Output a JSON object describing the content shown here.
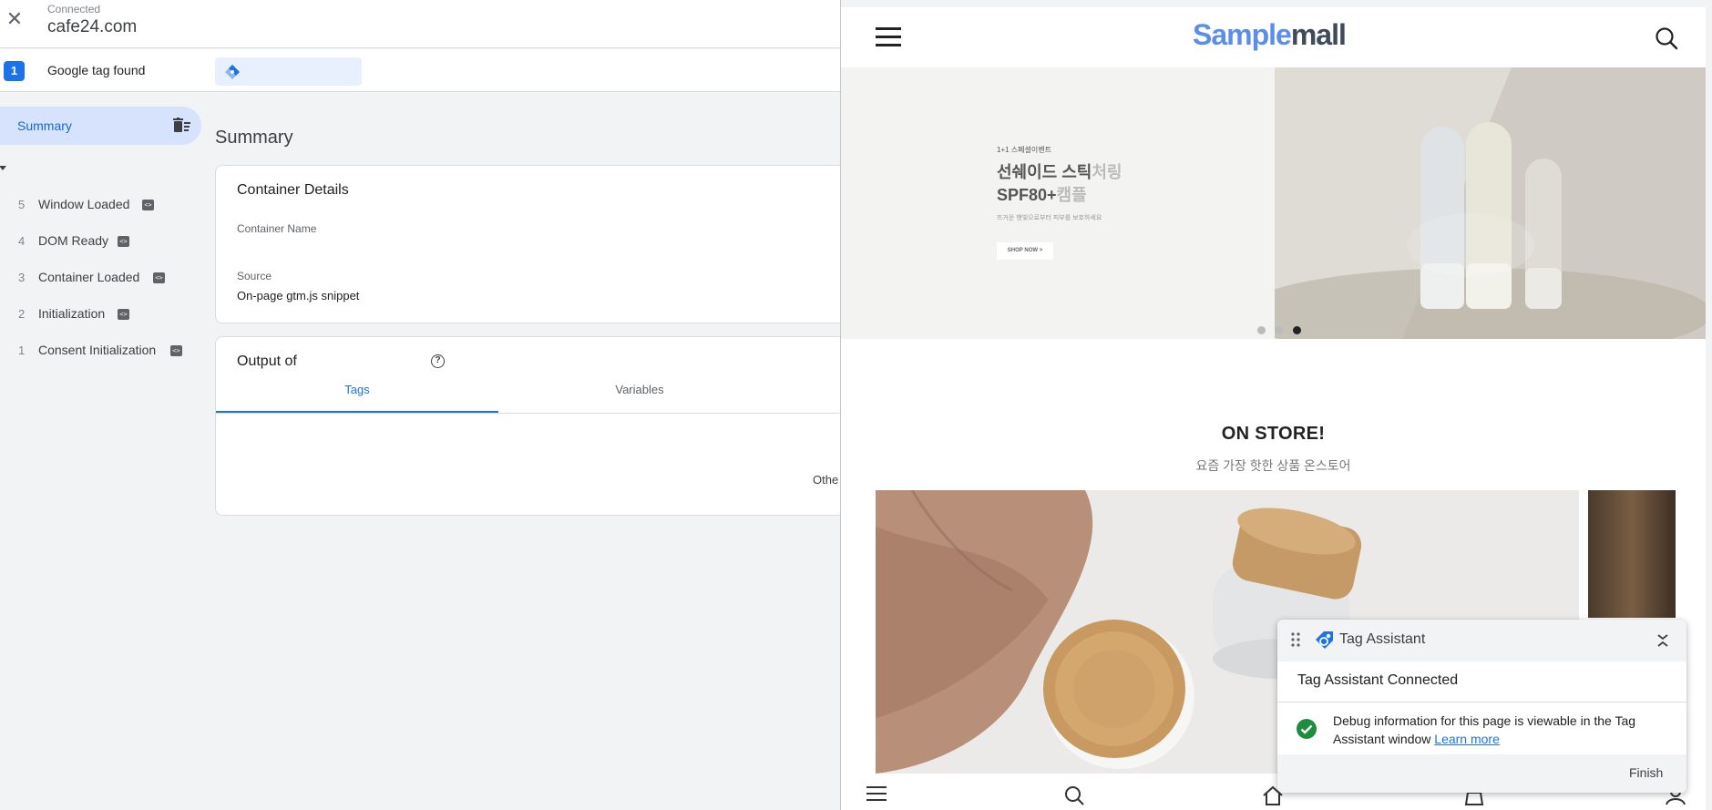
{
  "debugger": {
    "connection": {
      "status": "Connected",
      "domain": "cafe24.com"
    },
    "tag_bar": {
      "count": "1",
      "label": "Google tag found"
    },
    "nav": {
      "summary_label": "Summary"
    },
    "events": [
      {
        "num": "5",
        "name": "Window Loaded"
      },
      {
        "num": "4",
        "name": "DOM Ready"
      },
      {
        "num": "3",
        "name": "Container Loaded"
      },
      {
        "num": "2",
        "name": "Initialization"
      },
      {
        "num": "1",
        "name": "Consent Initialization"
      }
    ],
    "main": {
      "title": "Summary",
      "container_card": {
        "title": "Container Details",
        "name_label": "Container Name",
        "source_label": "Source",
        "source_value": "On-page gtm.js snippet"
      },
      "output_card": {
        "title": "Output of",
        "tabs": [
          "Tags",
          "Variables"
        ],
        "active_tab": "Tags",
        "body_text": "Othe"
      }
    }
  },
  "site": {
    "logo": {
      "part1": "Sample",
      "part2": "mall"
    },
    "banner": {
      "sub": "1+1 스페셜이벤트",
      "title_line1": "선쉐이드 스틱",
      "title_line1_ghost": "처링",
      "title_line2": "SPF80+",
      "title_line2_ghost": "캠플",
      "desc": "뜨거운 햇빛으로부터 피부를 보호하세요",
      "button": "SHOP NOW >",
      "slides": 3,
      "active_slide": 3
    },
    "section": {
      "title": "ON STORE!",
      "subtitle": "요즘 가장 핫한 상품 온스토어"
    }
  },
  "popup": {
    "title": "Tag Assistant",
    "status": "Tag Assistant Connected",
    "message": "Debug information for this page is viewable in the Tag Assistant window",
    "learn_more": "Learn more",
    "finish": "Finish"
  },
  "colors": {
    "accent": "#1a73e8",
    "nav_active_bg": "#d7e3fc",
    "logo_light": "#5c8ee8",
    "logo_dark": "#3f4a5a",
    "success": "#1e8e3e"
  }
}
